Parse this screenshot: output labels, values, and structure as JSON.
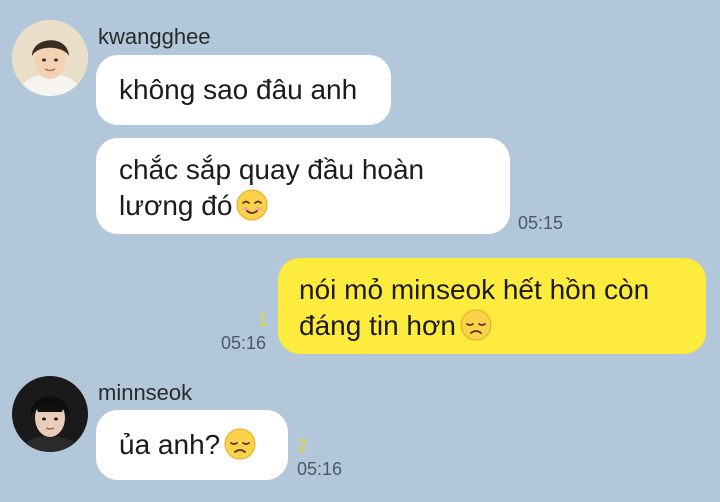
{
  "chat": {
    "colors": {
      "background": "#b2c7da",
      "incoming_bubble": "#ffffff",
      "outgoing_bubble": "#fdeb3d",
      "unread_count": "#e6d23a",
      "timestamp": "#4c5966"
    },
    "messages": [
      {
        "sender": "kwangghee",
        "direction": "incoming",
        "avatar_icon": "profile-photo",
        "bubbles": [
          {
            "text": "không sao đâu anh"
          },
          {
            "line1": "chắc sắp quay đầu hoàn",
            "line2": "lương đó",
            "emoji": "smiling-face-icon",
            "time": "05:15"
          }
        ]
      },
      {
        "direction": "outgoing",
        "bubbles": [
          {
            "line1": "nói mỏ minseok hết hồn còn",
            "line2": "đáng tin hơn",
            "emoji": "disappointed-face-icon",
            "unread": "1",
            "time": "05:16"
          }
        ]
      },
      {
        "sender": "minnseok",
        "direction": "incoming",
        "avatar_icon": "profile-photo",
        "bubbles": [
          {
            "text": "ủa anh?",
            "emoji": "disappointed-face-icon",
            "unread": "2",
            "time": "05:16"
          }
        ]
      }
    ]
  }
}
